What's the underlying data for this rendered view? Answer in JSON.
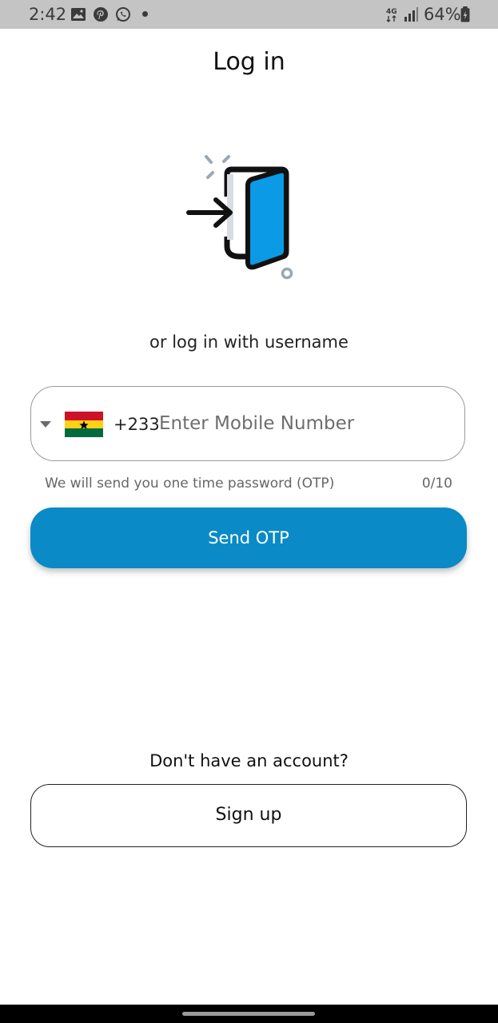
{
  "status_bar": {
    "time": "2:42",
    "battery": "64%",
    "network": "4G",
    "icons": [
      "gallery-icon",
      "pinterest-icon",
      "whatsapp-icon",
      "notification-dot",
      "network-4g-icon",
      "signal-icon",
      "battery-icon"
    ]
  },
  "header": {
    "title": "Log in"
  },
  "illustration": {
    "icon": "login-door-icon",
    "accent_color": "#0a9ae6"
  },
  "alt_login": {
    "label": "or log in with username"
  },
  "phone": {
    "country_flag": "ghana-flag-icon",
    "dial_code": "+233",
    "placeholder": "Enter Mobile Number",
    "value": "",
    "helper": "We will send you one time password (OTP)",
    "counter": "0/10"
  },
  "actions": {
    "send_otp_label": "Send OTP",
    "primary_color": "#0a8ac6"
  },
  "signup": {
    "prompt": "Don't have an account?",
    "button_label": "Sign up"
  }
}
